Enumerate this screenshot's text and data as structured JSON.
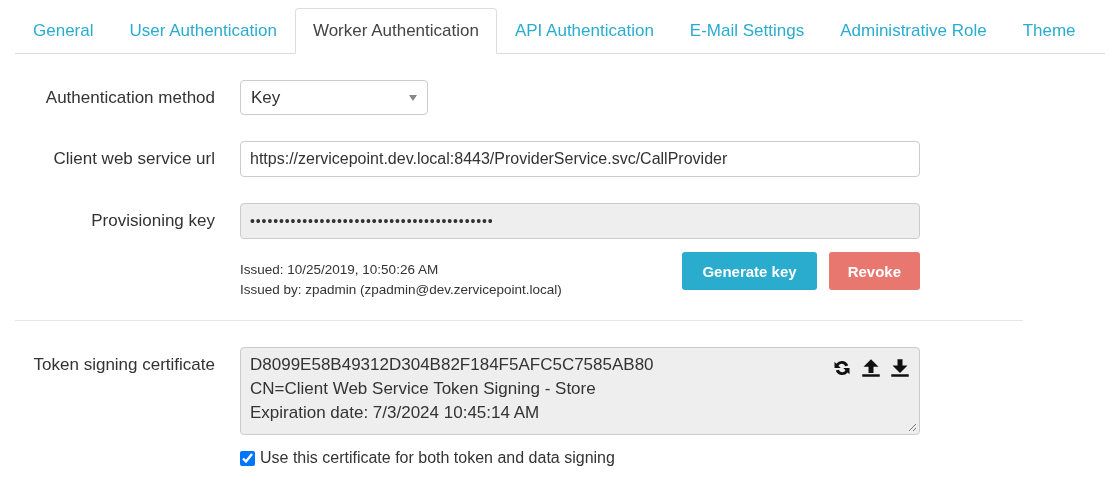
{
  "tabs": [
    {
      "label": "General",
      "selected": false
    },
    {
      "label": "User Authentication",
      "selected": false
    },
    {
      "label": "Worker Authentication",
      "selected": true
    },
    {
      "label": "API Authentication",
      "selected": false
    },
    {
      "label": "E-Mail Settings",
      "selected": false
    },
    {
      "label": "Administrative Role",
      "selected": false
    },
    {
      "label": "Theme",
      "selected": false
    }
  ],
  "authentication_method": {
    "label": "Authentication method",
    "value": "Key"
  },
  "client_web_service_url": {
    "label": "Client web service url",
    "value": "https://zervicepoint.dev.local:8443/ProviderService.svc/CallProvider"
  },
  "provisioning_key": {
    "label": "Provisioning key",
    "value": "••••••••••••••••••••••••••••••••••••••••••",
    "issued": "Issued: 10/25/2019, 10:50:26 AM",
    "issued_by": "Issued by: zpadmin (zpadmin@dev.zervicepoint.local)",
    "buttons": [
      {
        "label": "Generate key",
        "kind": "primary"
      },
      {
        "label": "Revoke",
        "kind": "danger"
      }
    ]
  },
  "token_signing_certificate": {
    "label": "Token signing certificate",
    "lines": [
      "D8099E58B49312D304B82F184F5AFC5C7585AB80",
      "CN=Client Web Service Token Signing - Store",
      "Expiration date: 7/3/2024 10:45:14 AM"
    ],
    "use_for_both": {
      "label": "Use this certificate for both token and data signing",
      "checked": true
    }
  }
}
